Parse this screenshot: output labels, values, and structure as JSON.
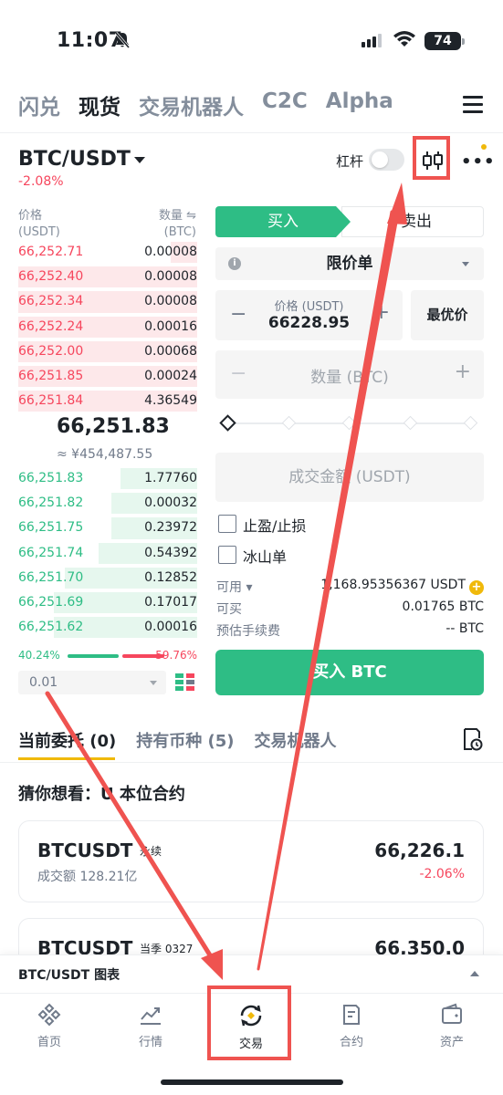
{
  "status_bar": {
    "time": "11:07",
    "battery": "74"
  },
  "top_tabs": [
    {
      "label": "闪兑",
      "active": false
    },
    {
      "label": "现货",
      "active": true
    },
    {
      "label": "交易机器人",
      "active": false
    },
    {
      "label": "C2C",
      "active": false
    },
    {
      "label": "Alpha",
      "active": false
    }
  ],
  "pair": {
    "symbol": "BTC/USDT",
    "change": "-2.08%",
    "leverage_label": "杠杆"
  },
  "orderbook": {
    "price_header": "价格",
    "price_unit": "(USDT)",
    "qty_header": "数量 ⇋",
    "qty_unit": "(BTC)",
    "asks": [
      {
        "price": "66,252.71",
        "qty": "0.00008",
        "depth": 0.15
      },
      {
        "price": "66,252.40",
        "qty": "0.00008",
        "depth": 1.0
      },
      {
        "price": "66,252.34",
        "qty": "0.00008",
        "depth": 1.0
      },
      {
        "price": "66,252.24",
        "qty": "0.00016",
        "depth": 1.0
      },
      {
        "price": "66,252.00",
        "qty": "0.00068",
        "depth": 1.0
      },
      {
        "price": "66,251.85",
        "qty": "0.00024",
        "depth": 1.0
      },
      {
        "price": "66,251.84",
        "qty": "4.36549",
        "depth": 1.0
      }
    ],
    "last_price": "66,251.83",
    "last_price_cny": "≈ ¥454,487.55",
    "bids": [
      {
        "price": "66,251.83",
        "qty": "1.77760",
        "depth": 0.43
      },
      {
        "price": "66,251.82",
        "qty": "0.00032",
        "depth": 0.48
      },
      {
        "price": "66,251.75",
        "qty": "0.23972",
        "depth": 0.48
      },
      {
        "price": "66,251.74",
        "qty": "0.54392",
        "depth": 0.55
      },
      {
        "price": "66,251.70",
        "qty": "0.12852",
        "depth": 0.74
      },
      {
        "price": "66,251.69",
        "qty": "0.17017",
        "depth": 0.8
      },
      {
        "price": "66,251.62",
        "qty": "0.00016",
        "depth": 0.8
      }
    ],
    "buy_ratio": "40.24%",
    "sell_ratio": "59.76%",
    "precision": "0.01"
  },
  "trade": {
    "buy_tab": "买入",
    "sell_tab": "卖出",
    "order_type": "限价单",
    "price_label": "价格 (USDT)",
    "price_value": "66228.95",
    "best_price": "最优价",
    "qty_label": "数量 (BTC)",
    "amount_label": "成交金额 (USDT)",
    "tp_sl": "止盈/止损",
    "iceberg": "冰山单",
    "available_label": "可用 ▾",
    "available_value": "1,168.95356367 USDT",
    "can_buy_label": "可买",
    "can_buy_value": "0.01765 BTC",
    "fee_label": "预估手续费",
    "fee_value": "-- BTC",
    "buy_button": "买入 BTC"
  },
  "order_tabs": [
    {
      "label": "当前委托 (0)",
      "active": true
    },
    {
      "label": "持有币种 (5)",
      "active": false
    },
    {
      "label": "交易机器人",
      "active": false
    }
  ],
  "suggest": {
    "title": "猜你想看：U 本位合约",
    "cards": [
      {
        "symbol": "BTCUSDT",
        "tag": "永续",
        "volume": "成交额 128.21亿",
        "price": "66,226.1",
        "change": "-2.06%"
      },
      {
        "symbol": "BTCUSDT",
        "tag": "当季 0327",
        "volume": "",
        "price": "66,350.0",
        "change": ""
      }
    ]
  },
  "chart_bar": {
    "label": "BTC/USDT 图表"
  },
  "bottom_nav": [
    {
      "label": "首页",
      "icon": "home-icon",
      "active": false
    },
    {
      "label": "行情",
      "icon": "markets-icon",
      "active": false
    },
    {
      "label": "交易",
      "icon": "trade-icon",
      "active": true
    },
    {
      "label": "合约",
      "icon": "futures-icon",
      "active": false
    },
    {
      "label": "资产",
      "icon": "wallet-icon",
      "active": false
    }
  ],
  "colors": {
    "green": "#2ebd85",
    "red": "#f6465d",
    "yellow": "#f0b90b",
    "annotation": "#ef5350"
  }
}
